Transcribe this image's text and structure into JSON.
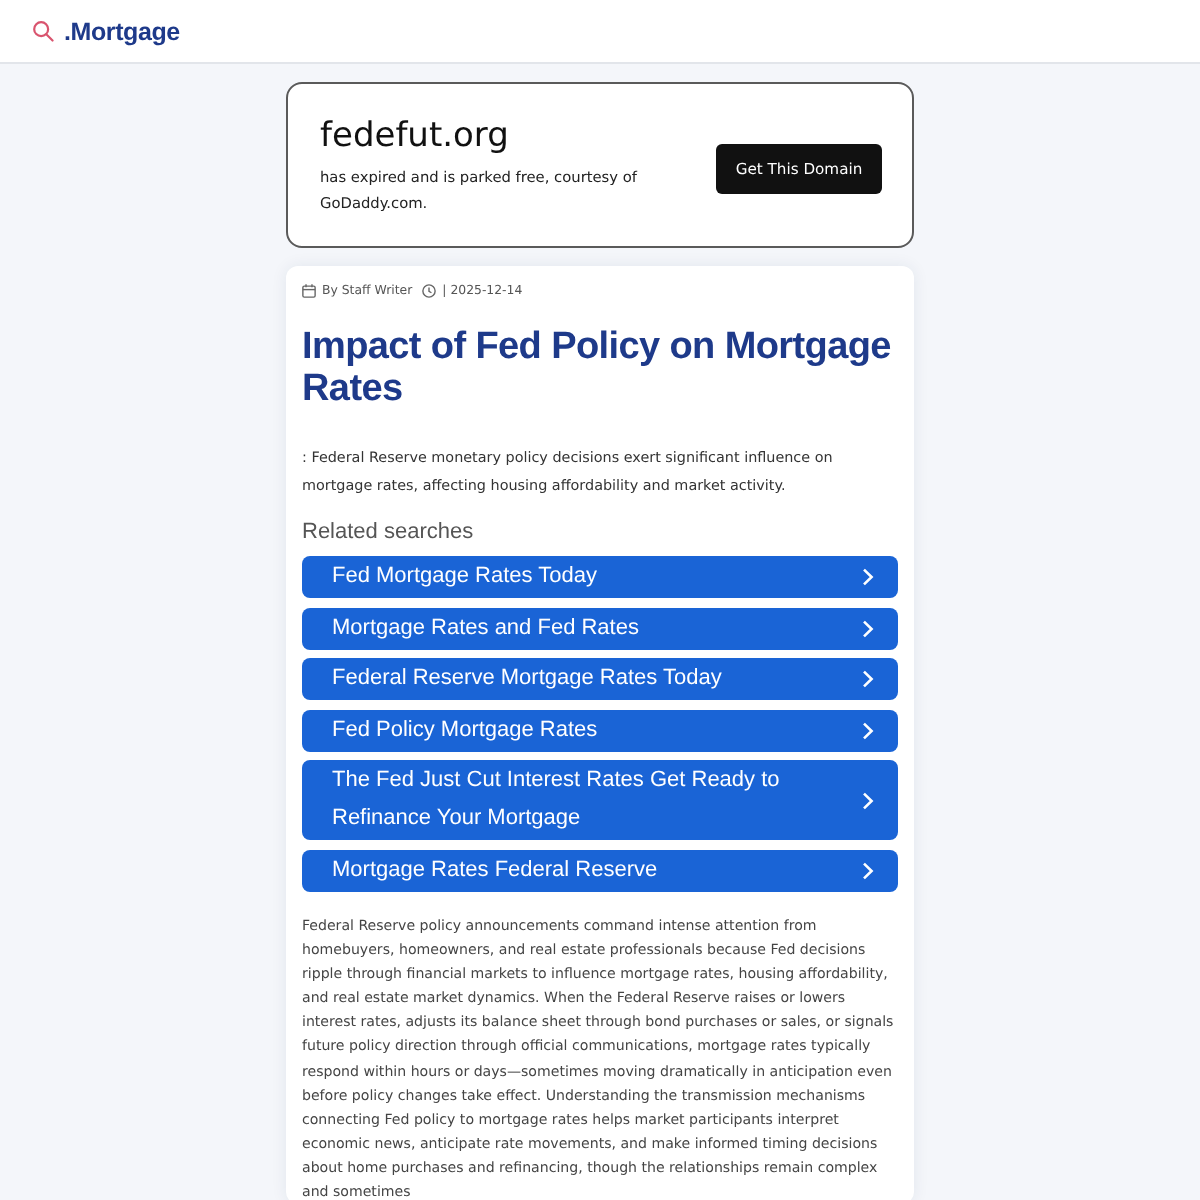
{
  "header": {
    "logo": ".Mortgage"
  },
  "domain_banner": {
    "domain": "fedefut.org",
    "message": "has expired and is parked free, courtesy of GoDaddy.com.",
    "button": "Get This Domain"
  },
  "article": {
    "author": "By Staff Writer",
    "date": "| 2025-12-14",
    "title": "Impact of Fed Policy on Mortgage Rates",
    "summary": ": Federal Reserve monetary policy decisions exert significant influence on mortgage rates, affecting housing affordability and market activity.",
    "related_heading": "Related searches",
    "related_searches": [
      "Fed Mortgage Rates Today",
      "Mortgage Rates and Fed Rates",
      "Federal Reserve Mortgage Rates Today",
      "Fed Policy Mortgage Rates",
      "The Fed Just Cut Interest Rates Get Ready to Refinance Your Mortgage",
      "Mortgage Rates Federal Reserve"
    ],
    "body": "Federal Reserve policy announcements command intense attention from homebuyers, homeowners, and real estate professionals because Fed decisions ripple through financial markets to influence mortgage rates, housing affordability, and real estate market dynamics. When the Federal Reserve raises or lowers interest rates, adjusts its balance sheet through bond purchases or sales, or signals future policy direction through official communications, mortgage rates typically respond within hours or days—sometimes moving dramatically in anticipation even before policy changes take effect. Understanding the transmission mechanisms connecting Fed policy to mortgage rates helps market participants interpret economic news, anticipate rate movements, and make informed timing decisions about home purchases and refinancing, though the relationships remain complex and sometimes"
  }
}
